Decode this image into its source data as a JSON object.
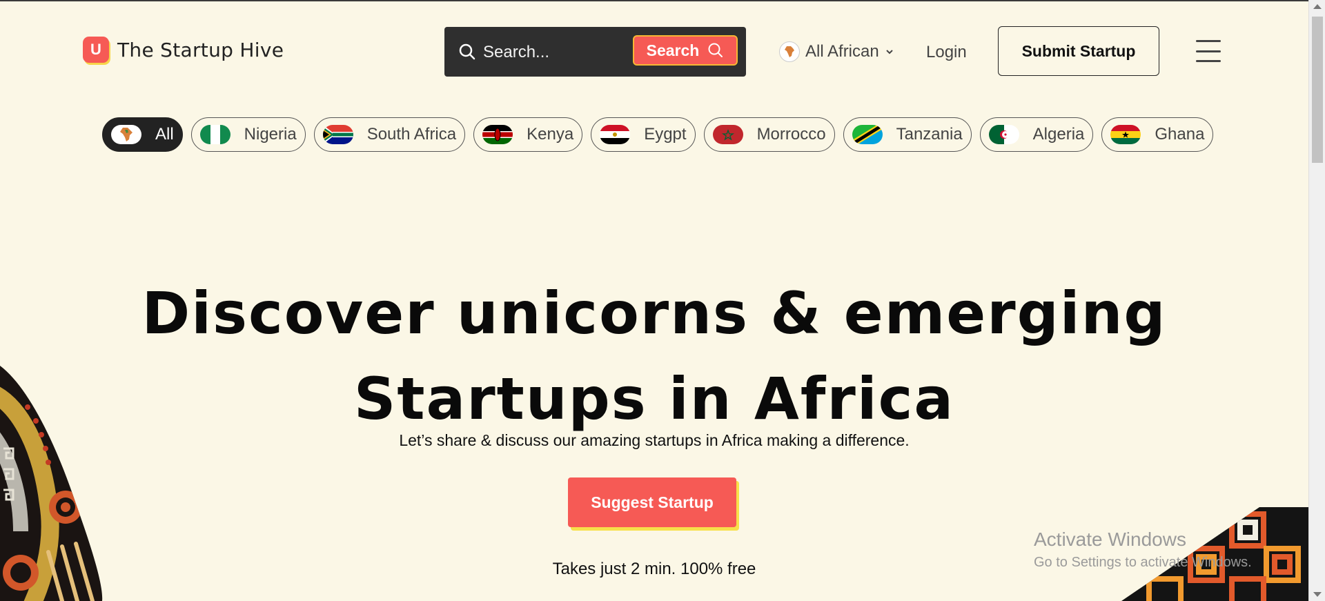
{
  "header": {
    "logo_letter": "U",
    "brand": "The Startup Hive",
    "search_placeholder": "Search...",
    "search_button": "Search",
    "region_label": "All African",
    "login": "Login",
    "submit": "Submit Startup"
  },
  "countries": [
    {
      "label": "All",
      "flag": "africa-map",
      "active": true
    },
    {
      "label": "Nigeria",
      "flag": "nigeria"
    },
    {
      "label": "South Africa",
      "flag": "south-africa"
    },
    {
      "label": "Kenya",
      "flag": "kenya"
    },
    {
      "label": "Eygpt",
      "flag": "egypt"
    },
    {
      "label": "Morrocco",
      "flag": "morocco"
    },
    {
      "label": "Tanzania",
      "flag": "tanzania"
    },
    {
      "label": "Algeria",
      "flag": "algeria"
    },
    {
      "label": "Ghana",
      "flag": "ghana"
    }
  ],
  "hero": {
    "title_line1": "Discover unicorns & emerging",
    "title_line2": "Startups in Africa",
    "subtitle": "Let’s share & discuss our amazing startups in Africa making a difference.",
    "cta": "Suggest Startup",
    "note": "Takes just 2 min. 100% free"
  },
  "watermark": {
    "line1": "Activate Windows",
    "line2": "Go to Settings to activate Windows."
  },
  "colors": {
    "background": "#fbf7e6",
    "accent": "#f65a55",
    "accent_shadow": "#f7e04a",
    "dark": "#2f2f2f"
  }
}
